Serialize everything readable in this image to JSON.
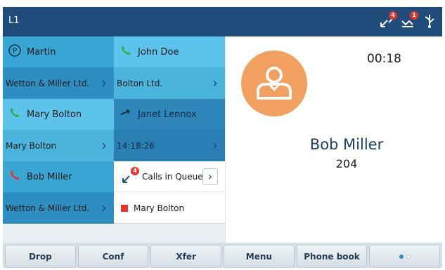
{
  "statusbar": {
    "line_label": "L1",
    "icons": [
      {
        "name": "missed-call-icon",
        "badge": "4"
      },
      {
        "name": "voicemail-icon",
        "badge": "1"
      },
      {
        "name": "usb-icon",
        "badge": ""
      }
    ]
  },
  "grid": [
    {
      "name": "Martin",
      "sub": "Wetton & Miller Ltd.",
      "icon": "park-icon"
    },
    {
      "name": "John Doe",
      "sub": "Bolton Ltd.",
      "icon": "phone-icon"
    },
    {
      "name": "Mary Bolton",
      "sub": "Mary Bolton",
      "icon": "phone-icon"
    },
    {
      "name": "Janet Lennox",
      "sub": "14:18:26",
      "icon": "call-forward-icon"
    },
    {
      "name": "Bob Miller",
      "sub": "Wetton & Miller Ltd.",
      "icon": "phone-red-icon"
    },
    {
      "queue_label": "Calls in Queue: 4",
      "queue_badge": "4",
      "member": "Mary Bolton"
    }
  ],
  "active_call": {
    "timer": "00:18",
    "name": "Bob Miller",
    "extension": "204"
  },
  "softkeys": [
    "Drop",
    "Conf",
    "Xfer",
    "Menu",
    "Phone book"
  ],
  "colors": {
    "header": "#1f4c7a",
    "accent": "#2d8fc1",
    "avatar": "#f2a060",
    "alert": "#e0362c",
    "page_dot_active": "#2d8fc1"
  }
}
